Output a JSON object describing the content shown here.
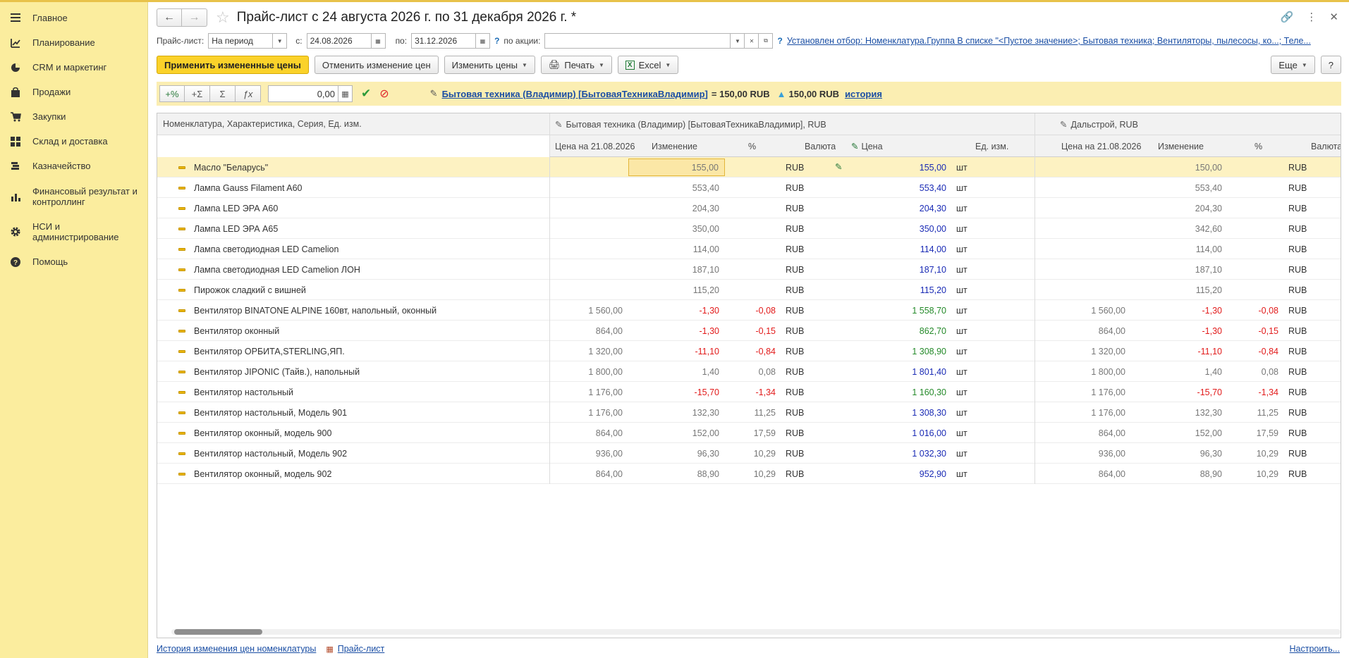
{
  "sidebar": {
    "items": [
      {
        "label": "Главное",
        "icon": "hamburger-icon"
      },
      {
        "label": "Планирование",
        "icon": "planning-icon"
      },
      {
        "label": "CRM и маркетинг",
        "icon": "pie-chart-icon"
      },
      {
        "label": "Продажи",
        "icon": "bag-icon"
      },
      {
        "label": "Закупки",
        "icon": "cart-icon"
      },
      {
        "label": "Склад и доставка",
        "icon": "warehouse-icon"
      },
      {
        "label": "Казначейство",
        "icon": "coins-icon"
      },
      {
        "label": "Финансовый результат и контроллинг",
        "icon": "bar-chart-icon"
      },
      {
        "label": "НСИ и администрирование",
        "icon": "gear-icon"
      },
      {
        "label": "Помощь",
        "icon": "help-icon"
      }
    ]
  },
  "header": {
    "title": "Прайс-лист с 24 августа 2026 г. по 31 декабря 2026 г. *"
  },
  "filters": {
    "pricelist_label": "Прайс-лист:",
    "pricelist_value": "На период",
    "from_label": "с:",
    "from_value": "24.08.2026",
    "to_label": "по:",
    "to_value": "31.12.2026",
    "promo_label": "по акции:",
    "promo_value": "",
    "filter_link": "Установлен отбор: Номенклатура.Группа В списке \"<Пустое значение>; Бытовая техника; Вентиляторы, пылесосы, ко...; Теле..."
  },
  "toolbar": {
    "apply": "Применить измененные цены",
    "cancel": "Отменить изменение цен",
    "change": "Изменить цены",
    "print": "Печать",
    "excel": "Excel",
    "more": "Еще",
    "help": "?"
  },
  "tools": {
    "plus_percent": "+%",
    "plus_sigma": "+Σ",
    "sigma": "Σ",
    "fx": "ƒx",
    "value": "0,00",
    "info_link": "Бытовая техника (Владимир) [БытоваяТехникаВладимир]",
    "info_eq": "= 150,00 RUB",
    "info_price": "150,00 RUB",
    "history": "история"
  },
  "table": {
    "col_main": "Номенклатура, Характеристика, Серия, Ед. изм.",
    "group1": "Бытовая техника (Владимир) [БытоваяТехникаВладимир], RUB",
    "group2": "Дальстрой, RUB",
    "sub": {
      "price_date": "Цена на 21.08.2026",
      "change": "Изменение",
      "pct": "%",
      "currency": "Валюта",
      "price": "Цена",
      "unit": "Ед. изм.",
      "price_date2": "Цена на 21.08.2026",
      "change2": "Изменение",
      "pct2": "%",
      "currency2": "Валюта"
    },
    "rows": [
      {
        "name": "Масло \"Беларусь\"",
        "p1": "",
        "c1": "155,00",
        "pct1": "",
        "cur1": "RUB",
        "price": "155,00",
        "unit": "шт",
        "p2": "",
        "c2": "150,00",
        "pct2": "",
        "cur2": "RUB"
      },
      {
        "name": "Лампа Gauss Filament A60",
        "p1": "",
        "c1": "553,40",
        "pct1": "",
        "cur1": "RUB",
        "price": "553,40",
        "unit": "шт",
        "p2": "",
        "c2": "553,40",
        "pct2": "",
        "cur2": "RUB"
      },
      {
        "name": "Лампа LED ЭРА А60",
        "p1": "",
        "c1": "204,30",
        "pct1": "",
        "cur1": "RUB",
        "price": "204,30",
        "unit": "шт",
        "p2": "",
        "c2": "204,30",
        "pct2": "",
        "cur2": "RUB"
      },
      {
        "name": "Лампа LED ЭРА А65",
        "p1": "",
        "c1": "350,00",
        "pct1": "",
        "cur1": "RUB",
        "price": "350,00",
        "unit": "шт",
        "p2": "",
        "c2": "342,60",
        "pct2": "",
        "cur2": "RUB"
      },
      {
        "name": "Лампа светодиодная LED Camelion",
        "p1": "",
        "c1": "114,00",
        "pct1": "",
        "cur1": "RUB",
        "price": "114,00",
        "unit": "шт",
        "p2": "",
        "c2": "114,00",
        "pct2": "",
        "cur2": "RUB"
      },
      {
        "name": "Лампа светодиодная LED Camelion ЛОН",
        "p1": "",
        "c1": "187,10",
        "pct1": "",
        "cur1": "RUB",
        "price": "187,10",
        "unit": "шт",
        "p2": "",
        "c2": "187,10",
        "pct2": "",
        "cur2": "RUB"
      },
      {
        "name": "Пирожок сладкий с вишней",
        "p1": "",
        "c1": "115,20",
        "pct1": "",
        "cur1": "RUB",
        "price": "115,20",
        "unit": "шт",
        "p2": "",
        "c2": "115,20",
        "pct2": "",
        "cur2": "RUB"
      },
      {
        "name": "Вентилятор BINATONE ALPINE 160вт, напольный, оконный",
        "p1": "1 560,00",
        "c1": "-1,30",
        "pct1": "-0,08",
        "cur1": "RUB",
        "price": "1 558,70",
        "unit": "шт",
        "p2": "1 560,00",
        "c2": "-1,30",
        "pct2": "-0,08",
        "cur2": "RUB"
      },
      {
        "name": "Вентилятор оконный",
        "p1": "864,00",
        "c1": "-1,30",
        "pct1": "-0,15",
        "cur1": "RUB",
        "price": "862,70",
        "unit": "шт",
        "p2": "864,00",
        "c2": "-1,30",
        "pct2": "-0,15",
        "cur2": "RUB"
      },
      {
        "name": "Вентилятор ОРБИТА,STERLING,ЯП.",
        "p1": "1 320,00",
        "c1": "-11,10",
        "pct1": "-0,84",
        "cur1": "RUB",
        "price": "1 308,90",
        "unit": "шт",
        "p2": "1 320,00",
        "c2": "-11,10",
        "pct2": "-0,84",
        "cur2": "RUB"
      },
      {
        "name": "Вентилятор JIPONIC (Тайв.), напольный",
        "p1": "1 800,00",
        "c1": "1,40",
        "pct1": "0,08",
        "cur1": "RUB",
        "price": "1 801,40",
        "unit": "шт",
        "p2": "1 800,00",
        "c2": "1,40",
        "pct2": "0,08",
        "cur2": "RUB"
      },
      {
        "name": "Вентилятор настольный",
        "p1": "1 176,00",
        "c1": "-15,70",
        "pct1": "-1,34",
        "cur1": "RUB",
        "price": "1 160,30",
        "unit": "шт",
        "p2": "1 176,00",
        "c2": "-15,70",
        "pct2": "-1,34",
        "cur2": "RUB"
      },
      {
        "name": "Вентилятор настольный, Модель 901",
        "p1": "1 176,00",
        "c1": "132,30",
        "pct1": "11,25",
        "cur1": "RUB",
        "price": "1 308,30",
        "unit": "шт",
        "p2": "1 176,00",
        "c2": "132,30",
        "pct2": "11,25",
        "cur2": "RUB"
      },
      {
        "name": "Вентилятор оконный, модель 900",
        "p1": "864,00",
        "c1": "152,00",
        "pct1": "17,59",
        "cur1": "RUB",
        "price": "1 016,00",
        "unit": "шт",
        "p2": "864,00",
        "c2": "152,00",
        "pct2": "17,59",
        "cur2": "RUB"
      },
      {
        "name": "Вентилятор настольный, Модель 902",
        "p1": "936,00",
        "c1": "96,30",
        "pct1": "10,29",
        "cur1": "RUB",
        "price": "1 032,30",
        "unit": "шт",
        "p2": "936,00",
        "c2": "96,30",
        "pct2": "10,29",
        "cur2": "RUB"
      },
      {
        "name": "Вентилятор оконный, модель 902",
        "p1": "864,00",
        "c1": "88,90",
        "pct1": "10,29",
        "cur1": "RUB",
        "price": "952,90",
        "unit": "шт",
        "p2": "864,00",
        "c2": "88,90",
        "pct2": "10,29",
        "cur2": "RUB"
      }
    ]
  },
  "footer": {
    "history_link": "История изменения цен номенклатуры",
    "pricelist_link": "Прайс-лист",
    "configure_link": "Настроить..."
  },
  "colors": {
    "sidebar_bg": "#fbed9e",
    "primary_button": "#fbd22a",
    "selected_row": "#fdf2c2",
    "negative": "#e21b1b",
    "link": "#1a4ea4"
  }
}
